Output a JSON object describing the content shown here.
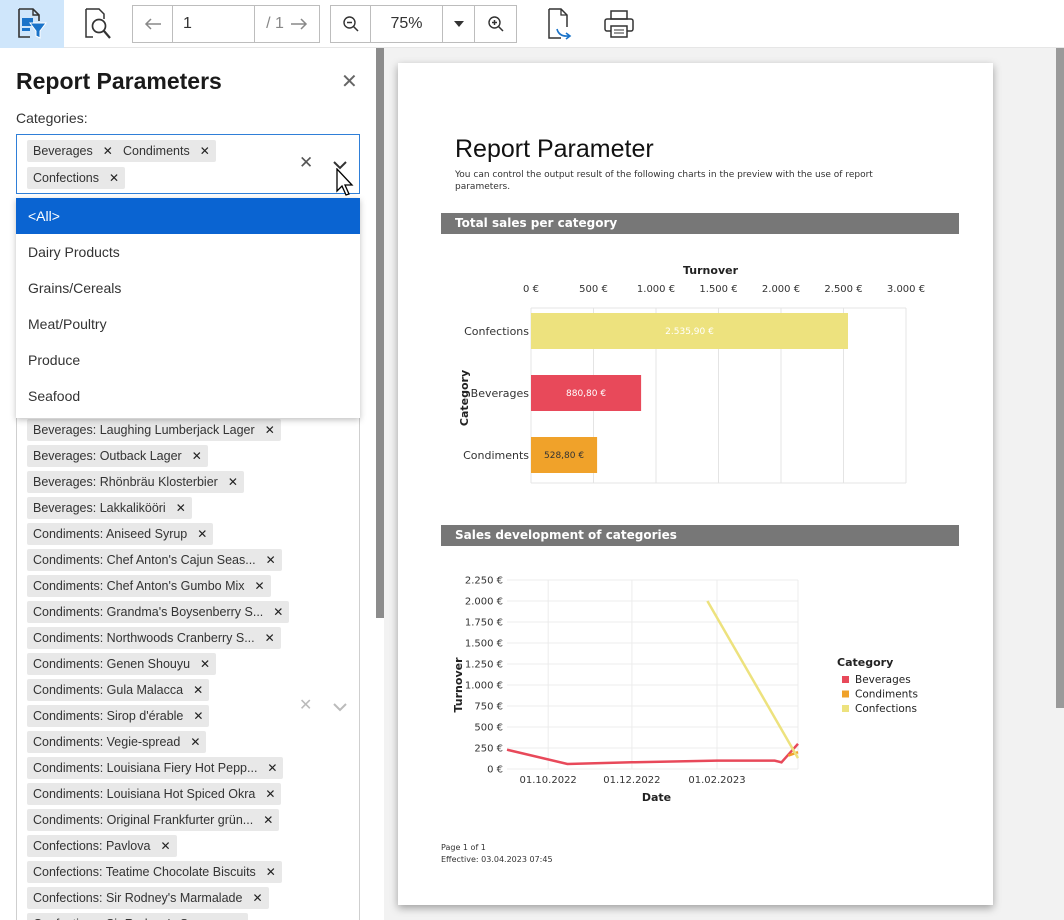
{
  "toolbar": {
    "page_current": "1",
    "page_total": "/ 1",
    "zoom": "75%",
    "icons": [
      "parameters-icon",
      "search-icon",
      "arrow-left-icon",
      "arrow-right-icon",
      "zoom-out-icon",
      "caret-down-icon",
      "zoom-in-icon",
      "export-icon",
      "print-icon"
    ]
  },
  "panel": {
    "title": "Report Parameters",
    "categories_label": "Categories:",
    "selected_categories": [
      "Beverages",
      "Condiments",
      "Confections"
    ],
    "dropdown_options": [
      "<All>",
      "Dairy Products",
      "Grains/Cereals",
      "Meat/Poultry",
      "Produce",
      "Seafood"
    ],
    "products": [
      "Beverages: Laughing Lumberjack Lager",
      "Beverages: Outback Lager",
      "Beverages: Rhönbräu Klosterbier",
      "Beverages: Lakkalikööri",
      "Condiments: Aniseed Syrup",
      "Condiments: Chef Anton's Cajun Seas...",
      "Condiments: Chef Anton's Gumbo Mix",
      "Condiments: Grandma's Boysenberry S...",
      "Condiments: Northwoods Cranberry S...",
      "Condiments: Genen Shouyu",
      "Condiments: Gula Malacca",
      "Condiments: Sirop d'érable",
      "Condiments: Vegie-spread",
      "Condiments: Louisiana Fiery Hot Pepp...",
      "Condiments: Louisiana Hot Spiced Okra",
      "Condiments: Original Frankfurter grün...",
      "Confections: Pavlova",
      "Confections: Teatime Chocolate Biscuits",
      "Confections: Sir Rodney's Marmalade",
      "Confections: Sir Rodney's Scones"
    ]
  },
  "report": {
    "title": "Report Parameter",
    "description": "You can control the output result of the following charts in the preview with the use of report parameters.",
    "section1": "Total sales per category",
    "section2": "Sales development of categories",
    "footer_page": "Page 1 of 1",
    "footer_effective": "Effective: 03.04.2023 07:45"
  },
  "colors": {
    "Beverages": "#e8495a",
    "Condiments": "#f0a22a",
    "Confections": "#ede27e",
    "accent": "#0a64d2"
  },
  "chart_data": [
    {
      "type": "bar",
      "orientation": "horizontal",
      "title": "Total sales per category",
      "xlabel": "Turnover",
      "ylabel": "Category",
      "categories": [
        "Confections",
        "Beverages",
        "Condiments"
      ],
      "values": [
        2535.9,
        880.8,
        528.8
      ],
      "value_labels": [
        "2.535,90 €",
        "880,80 €",
        "528,80 €"
      ],
      "xticks": [
        "0 €",
        "500 €",
        "1.000 €",
        "1.500 €",
        "2.000 €",
        "2.500 €",
        "3.000 €"
      ],
      "xlim": [
        0,
        3000
      ],
      "grid": true
    },
    {
      "type": "line",
      "title": "Sales development of categories",
      "xlabel": "Date",
      "ylabel": "Turnover",
      "legend_title": "Category",
      "legend_position": "right",
      "xticks": [
        "01.10.2022",
        "01.12.2022",
        "01.02.2023"
      ],
      "yticks": [
        "0 €",
        "250 €",
        "500 €",
        "750 €",
        "1.000 €",
        "1.250 €",
        "1.500 €",
        "1.750 €",
        "2.000 €",
        "2.250 €"
      ],
      "ylim": [
        0,
        2250
      ],
      "grid": true,
      "series": [
        {
          "name": "Beverages",
          "points": [
            [
              "2022-09-01",
              230
            ],
            [
              "2022-10-15",
              60
            ],
            [
              "2022-12-01",
              80
            ],
            [
              "2023-02-01",
              100
            ],
            [
              "2023-03-15",
              100
            ],
            [
              "2023-03-20",
              80
            ],
            [
              "2023-04-01",
              300
            ]
          ]
        },
        {
          "name": "Condiments",
          "points": [
            [
              "2023-03-25",
              160
            ],
            [
              "2023-04-01",
              200
            ]
          ]
        },
        {
          "name": "Confections",
          "points": [
            [
              "2023-01-25",
              2000
            ],
            [
              "2023-04-01",
              130
            ]
          ]
        }
      ]
    }
  ]
}
